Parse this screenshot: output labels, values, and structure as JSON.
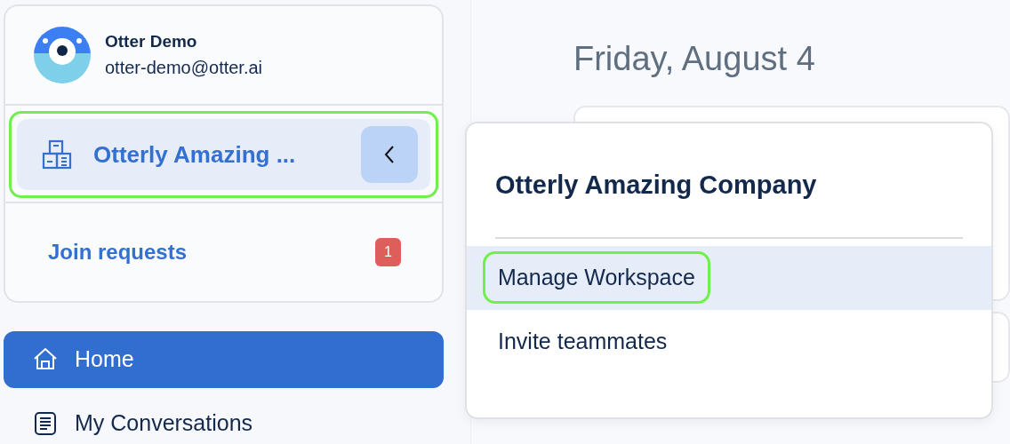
{
  "user": {
    "name": "Otter Demo",
    "email": "otter-demo@otter.ai"
  },
  "workspace": {
    "name": "Otterly Amazing ...",
    "highlighted": true
  },
  "join_requests": {
    "label": "Join requests",
    "count": "1"
  },
  "nav": [
    {
      "label": "Home",
      "kind": "home",
      "selected": true
    },
    {
      "label": "My Conversations",
      "kind": "conversations",
      "selected": false
    }
  ],
  "date": "Friday, August 4",
  "menu": {
    "title": "Otterly Amazing Company",
    "items": [
      {
        "label": "Manage Workspace",
        "selected": true,
        "highlighted": true
      },
      {
        "label": "Invite teammates",
        "selected": false,
        "highlighted": false
      }
    ]
  }
}
